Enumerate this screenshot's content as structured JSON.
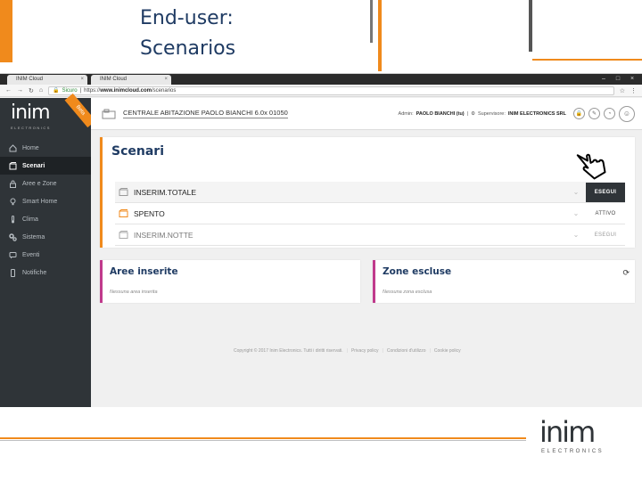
{
  "slide": {
    "title_line1": "End-user:",
    "title_line2": "Scenarios",
    "brand_color": "#f08a1c",
    "footer_logo": "inim",
    "footer_logo_sub": "ELECTRONICS"
  },
  "browser": {
    "tabs": [
      {
        "label": "INIM Cloud",
        "icon": "inim-tab-icon"
      },
      {
        "label": "INIM Cloud",
        "icon": "inim-tab-icon"
      }
    ],
    "address": {
      "secure_label": "Sicuro",
      "url_prefix": "https://",
      "url_host": "www.inimcloud.com",
      "url_path": "/scenarios"
    }
  },
  "app": {
    "logo": "inim",
    "logo_sub": "ELECTRONICS",
    "badge": "Beta",
    "sidebar": {
      "items": [
        {
          "label": "Home",
          "icon": "home-icon"
        },
        {
          "label": "Scenari",
          "icon": "scenari-icon",
          "active": true
        },
        {
          "label": "Aree e Zone",
          "icon": "lock-icon"
        },
        {
          "label": "Smart Home",
          "icon": "bulb-icon"
        },
        {
          "label": "Clima",
          "icon": "thermometer-icon"
        },
        {
          "label": "Sistema",
          "icon": "gears-icon"
        },
        {
          "label": "Eventi",
          "icon": "events-icon"
        },
        {
          "label": "Notifiche",
          "icon": "phone-icon"
        }
      ]
    },
    "topbar": {
      "central_name": "CENTRALE ABITAZIONE PAOLO BIANCHI 6.0x 01050",
      "admin_label": "Admin:",
      "admin_name": "PAOLO BIANCHI (tu)",
      "supervisor_label": "Supervisore:",
      "supervisor_name": "INIM ELECTRONICS SRL"
    },
    "scenari": {
      "title": "Scenari",
      "rows": [
        {
          "label": "INSERIM.TOTALE",
          "action": "ESEGUI"
        },
        {
          "label": "SPENTO",
          "action": "ATTIVO"
        },
        {
          "label": "INSERIM.NOTTE",
          "action": "ESEGUI"
        }
      ]
    },
    "aree_inserite": {
      "title": "Aree inserite",
      "subtitle": "Nessuna area inserita"
    },
    "zone_escluse": {
      "title": "Zone escluse",
      "subtitle": "Nessuna zona esclusa"
    },
    "footer": {
      "copyright": "Copyright © 2017 Inim Electronics. Tutti i diritti riservati.",
      "privacy": "Privacy policy",
      "conditions": "Condizioni d'utilizzo",
      "cookie": "Cookie policy"
    }
  }
}
